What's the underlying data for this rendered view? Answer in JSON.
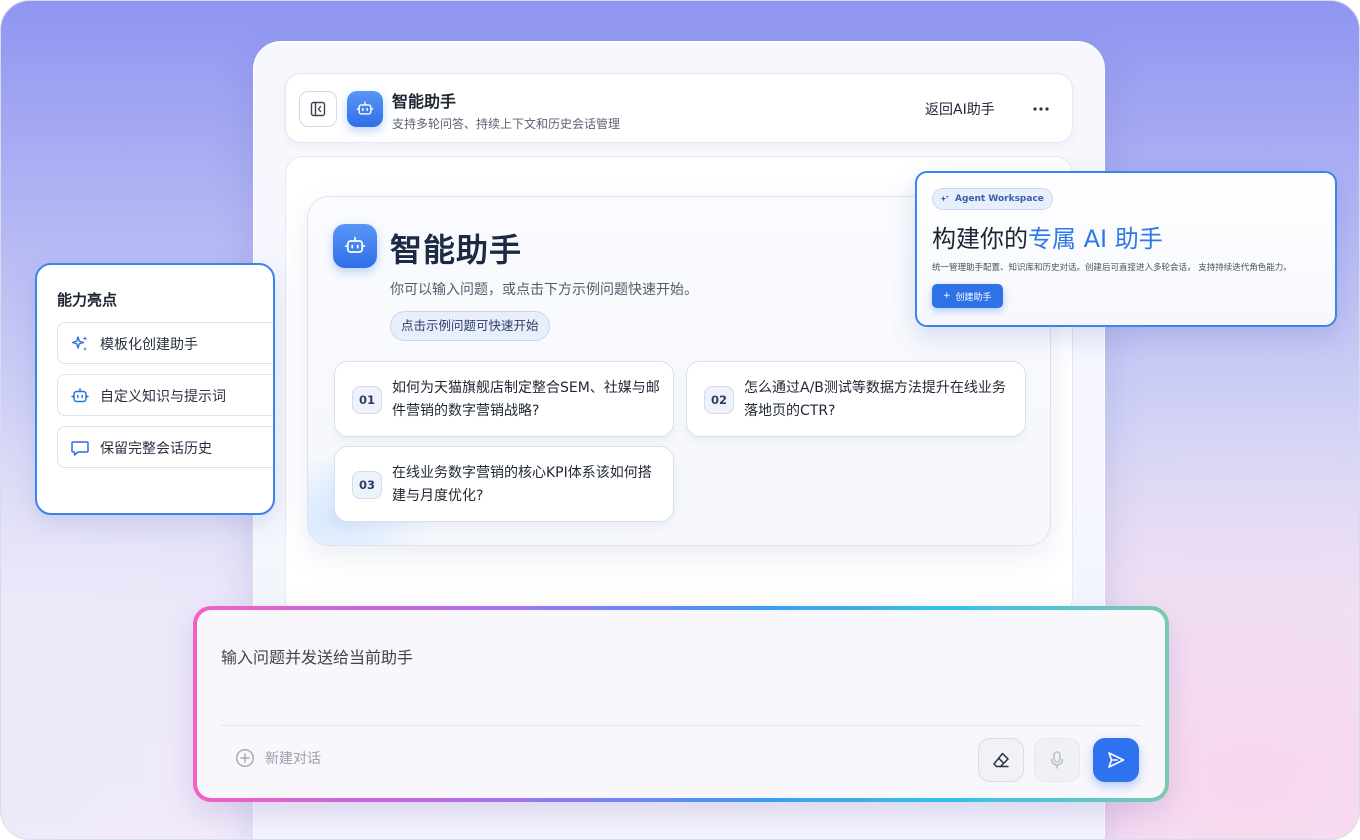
{
  "header": {
    "title": "智能助手",
    "subtitle": "支持多轮问答、持续上下文和历史会话管理",
    "back_label": "返回AI助手",
    "icons": {
      "sidebar_toggle": "sidebar-collapse-icon",
      "assistant": "robot-icon",
      "more": "more-horizontal-icon"
    }
  },
  "welcome": {
    "title": "智能助手",
    "subtitle": "你可以输入问题，或点击下方示例问题快速开始。",
    "chip": "点击示例问题可快速开始",
    "questions": [
      {
        "num": "01",
        "text": "如何为天猫旗舰店制定整合SEM、社媒与邮件营销的数字营销战略?"
      },
      {
        "num": "02",
        "text": "怎么通过A/B测试等数据方法提升在线业务落地页的CTR?"
      },
      {
        "num": "03",
        "text": "在线业务数字营销的核心KPI体系该如何搭建与月度优化?"
      }
    ]
  },
  "capabilities": {
    "title": "能力亮点",
    "items": [
      {
        "label": "模板化创建助手",
        "icon": "sparkles-icon"
      },
      {
        "label": "自定义知识与提示词",
        "icon": "robot-icon"
      },
      {
        "label": "保留完整会话历史",
        "icon": "chat-bubble-icon"
      }
    ]
  },
  "agent_card": {
    "chip": "Agent Workspace",
    "title_prefix": "构建你的",
    "title_highlight": "专属 AI 助手",
    "description": "统一管理助手配置、知识库和历史对话。创建后可直接进入多轮会话， 支持持续迭代角色能力。",
    "button": "创建助手",
    "button_icon": "+"
  },
  "composer": {
    "input_text": "输入问题并发送给当前助手",
    "new_chat": "新建对话",
    "icons": {
      "new_chat": "plus-circle-icon",
      "clear": "eraser-icon",
      "voice": "microphone-icon",
      "send": "send-icon"
    }
  },
  "colors": {
    "accent": "#2f72e6",
    "highlight_border": "#3a84ea"
  }
}
